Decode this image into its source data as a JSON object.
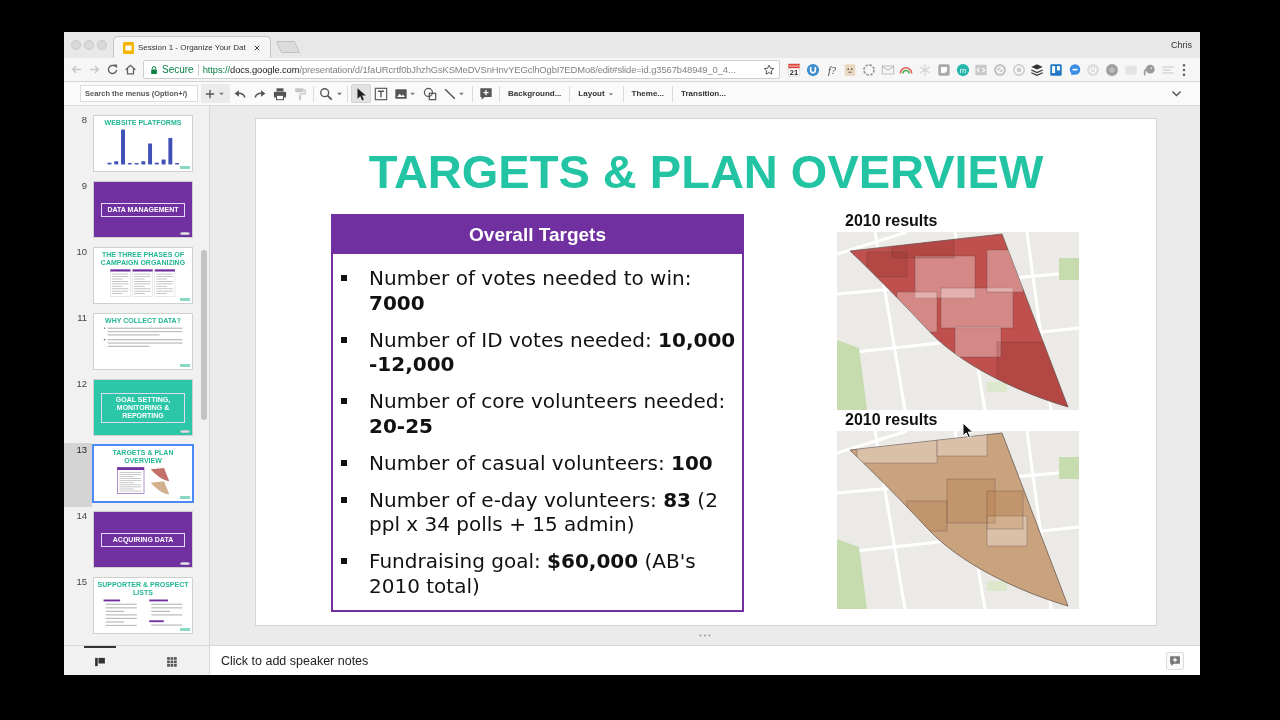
{
  "browser": {
    "tab_title": "Session 1 - Organize Your Dat",
    "profile": "Chris",
    "navigation": [
      {
        "kind": "back",
        "disabled": true
      },
      {
        "kind": "forward",
        "disabled": true
      },
      {
        "kind": "reload",
        "disabled": false
      },
      {
        "kind": "home",
        "disabled": false
      }
    ],
    "secure_label": "Secure",
    "url": {
      "scheme": "https://",
      "host": "docs.google.com",
      "path": "/presentation/d/1faURcrtf0bJhzhGsKSMeDVSnHnvYEGclhOgbI7EDMo8/edit#slide=id.g3567b48949_0_4..."
    },
    "extensions": {
      "calendar_date": "21",
      "formula": "f?",
      "badge_letter": "m"
    }
  },
  "toolbar": {
    "search": {
      "placeholder": "Search the menus (Option+/)"
    },
    "actions": [
      {
        "kind": "undo",
        "disabled": false
      },
      {
        "kind": "redo",
        "disabled": false
      },
      {
        "kind": "print",
        "disabled": false
      },
      {
        "kind": "paint_format",
        "disabled": true
      }
    ],
    "tools": [
      {
        "kind": "select",
        "selected": true
      },
      {
        "kind": "text_box",
        "selected": false
      },
      {
        "kind": "image",
        "selected": false
      },
      {
        "kind": "shape",
        "selected": false
      },
      {
        "kind": "line",
        "selected": false
      }
    ],
    "menu_buttons": [
      {
        "label": "Background...",
        "dropdown": false
      },
      {
        "label": "Layout",
        "dropdown": true
      },
      {
        "label": "Theme...",
        "dropdown": false
      },
      {
        "label": "Transition...",
        "dropdown": false
      }
    ]
  },
  "filmstrip": {
    "slides": [
      {
        "number": "8",
        "kind": "chart",
        "title": "WEBSITE PLATFORMS",
        "selected": false
      },
      {
        "number": "9",
        "kind": "section",
        "title": "DATA MANAGEMENT",
        "color": "#7030a0",
        "selected": false
      },
      {
        "number": "10",
        "kind": "columns",
        "title": "THE THREE PHASES OF CAMPAIGN ORGANIZING",
        "selected": false
      },
      {
        "number": "11",
        "kind": "bullets",
        "title": "WHY COLLECT DATA?",
        "selected": false
      },
      {
        "number": "12",
        "kind": "section",
        "title": "GOAL SETTING, MONITORING & REPORTING",
        "color": "#2cc7a8",
        "selected": false
      },
      {
        "number": "13",
        "kind": "overview",
        "title": "TARGETS & PLAN OVERVIEW",
        "selected": true
      },
      {
        "number": "14",
        "kind": "section",
        "title": "ACQUIRING DATA",
        "color": "#7030a0",
        "selected": false
      },
      {
        "number": "15",
        "kind": "lists",
        "title": "SUPPORTER & PROSPECT LISTS",
        "selected": false
      }
    ],
    "view_toggles": [
      {
        "kind": "list",
        "selected": true
      },
      {
        "kind": "grid",
        "selected": false
      }
    ]
  },
  "slide": {
    "title": "TARGETS & PLAN OVERVIEW",
    "targets": {
      "heading": "Overall Targets",
      "items": [
        "Number of votes needed to win: **7000**",
        "Number of ID votes needed: **10,000 -12,000**",
        "Number of core volunteers needed: **20-25**",
        "Number of casual volunteers: **100**",
        "Number of e-day volunteers: **83** (2 ppl x 34 polls + 15 admin)",
        "Fundraising goal: **$60,000** (AB's 2010 total)"
      ]
    },
    "maps": [
      {
        "label": "2010 results",
        "color": "#c0504d"
      },
      {
        "label": "2010 results",
        "color": "#c9a27e"
      }
    ]
  },
  "notes": {
    "placeholder": "Click to add speaker notes"
  }
}
